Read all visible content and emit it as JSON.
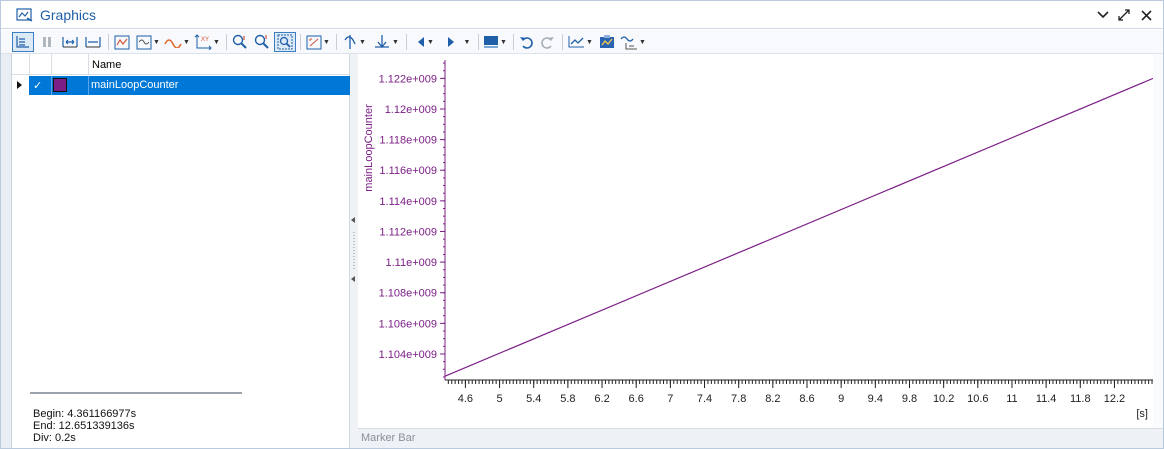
{
  "window": {
    "title": "Graphics",
    "controls": [
      "chevron-down",
      "expand",
      "close"
    ]
  },
  "toolbar": {
    "buttons": [
      "signals-table-icon",
      "pause-icon",
      "zoom-x-icon",
      "fit-x-icon",
      "auto-scale-icon",
      "signal-style-icon",
      "curve-icon",
      "axis-settings-icon",
      "zoom-in-icon",
      "zoom-out-icon",
      "zoom-select-icon",
      "fit-all-icon",
      "cursor-icon",
      "marker-icon",
      "previous-icon",
      "next-icon",
      "layout-icon",
      "undo-icon",
      "redo-icon",
      "chart-type-icon",
      "export-icon",
      "measure-icon"
    ]
  },
  "signals": {
    "header_name": "Name",
    "rows": [
      {
        "name": "mainLoopCounter",
        "checked": true,
        "color": "#7b1f86"
      }
    ]
  },
  "info": {
    "begin": "Begin: 4.361166977s",
    "end": "End: 12.651339136s",
    "div": "Div: 0.2s"
  },
  "marker_bar": {
    "label": "Marker Bar"
  },
  "chart_data": {
    "type": "line",
    "xunit": "[s]",
    "ylabel": "mainLoopCounter",
    "xlim": [
      4.361166977,
      12.651339136
    ],
    "ylim": [
      1102300000.0,
      1123200000.0
    ],
    "x_ticks": [
      "4.6",
      "5",
      "5.4",
      "5.8",
      "6.2",
      "6.6",
      "7",
      "7.4",
      "7.8",
      "8.2",
      "8.6",
      "9",
      "9.4",
      "9.8",
      "10.2",
      "10.6",
      "11",
      "11.4",
      "11.8",
      "12.2"
    ],
    "x_tick_values": [
      4.6,
      5.0,
      5.4,
      5.8,
      6.2,
      6.6,
      7.0,
      7.4,
      7.8,
      8.2,
      8.6,
      9.0,
      9.4,
      9.8,
      10.2,
      10.6,
      11.0,
      11.4,
      11.8,
      12.2
    ],
    "y_ticks": [
      "1.104e+009",
      "1.106e+009",
      "1.108e+009",
      "1.11e+009",
      "1.112e+009",
      "1.114e+009",
      "1.116e+009",
      "1.118e+009",
      "1.12e+009",
      "1.122e+009"
    ],
    "y_tick_values": [
      1104000000.0,
      1106000000.0,
      1108000000.0,
      1110000000.0,
      1112000000.0,
      1114000000.0,
      1116000000.0,
      1118000000.0,
      1120000000.0,
      1122000000.0
    ],
    "series": [
      {
        "name": "mainLoopCounter",
        "color": "#7b1f86",
        "x": [
          4.361166977,
          12.651339136
        ],
        "y": [
          1102550000.0,
          1122000000.0
        ]
      }
    ]
  }
}
